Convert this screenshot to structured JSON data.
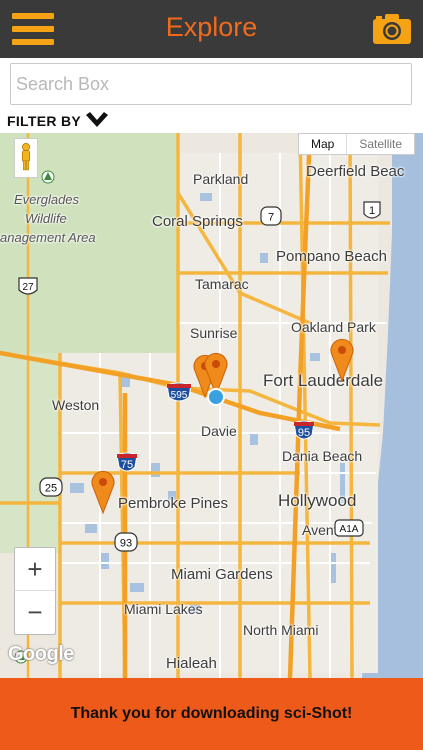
{
  "header": {
    "title": "Explore",
    "menu_icon": "hamburger-menu-icon",
    "camera_icon": "camera-icon",
    "accent_color": "#f06a1c",
    "icon_color": "#f5a214",
    "bar_color": "#3a3a3a"
  },
  "search": {
    "placeholder": "Search Box",
    "value": ""
  },
  "filter": {
    "label": "FILTER BY",
    "icon": "chevron-down-icon"
  },
  "map": {
    "type_buttons": {
      "map": "Map",
      "satellite": "Satellite",
      "selected": "Map"
    },
    "zoom_in": "+",
    "zoom_out": "−",
    "attribution": "Google",
    "pegman_icon": "pegman-icon",
    "labels": {
      "parkland": "Parkland",
      "deerfield": "Deerfield Beac",
      "coral_springs": "Coral Springs",
      "everglades1": "Everglades",
      "everglades2": "Wildlife",
      "everglades3": "anagement Area",
      "pompano": "Pompano Beach",
      "tamarac": "Tamarac",
      "oakland": "Oakland Park",
      "sunrise": "Sunrise",
      "fort_lauderdale": "Fort Lauderdale",
      "weston": "Weston",
      "davie": "Davie",
      "dania": "Dania Beach",
      "pembroke": "Pembroke Pines",
      "hollywood": "Hollywood",
      "aventura": "Aventura",
      "miami_gardens": "Miami Gardens",
      "miami_lakes": "Miami Lakes",
      "north_miami": "North Miami",
      "hialeah": "Hialeah"
    },
    "shields": {
      "fl7": "7",
      "us1": "1",
      "us27": "27",
      "i595": "595",
      "i95": "95",
      "i75": "75",
      "fl25": "25",
      "fl93": "93",
      "a1a": "A1A"
    },
    "markers": [
      {
        "icon": "map-pin-icon",
        "color": "#f08a1a"
      },
      {
        "icon": "map-pin-icon",
        "color": "#f08a1a"
      },
      {
        "icon": "map-pin-icon",
        "color": "#f08a1a"
      },
      {
        "icon": "map-pin-icon",
        "color": "#f08a1a"
      }
    ],
    "current_location_icon": "current-location-dot-icon"
  },
  "footer": {
    "message": "Thank you for downloading sci-Shot!",
    "color": "#ee5a1a"
  }
}
